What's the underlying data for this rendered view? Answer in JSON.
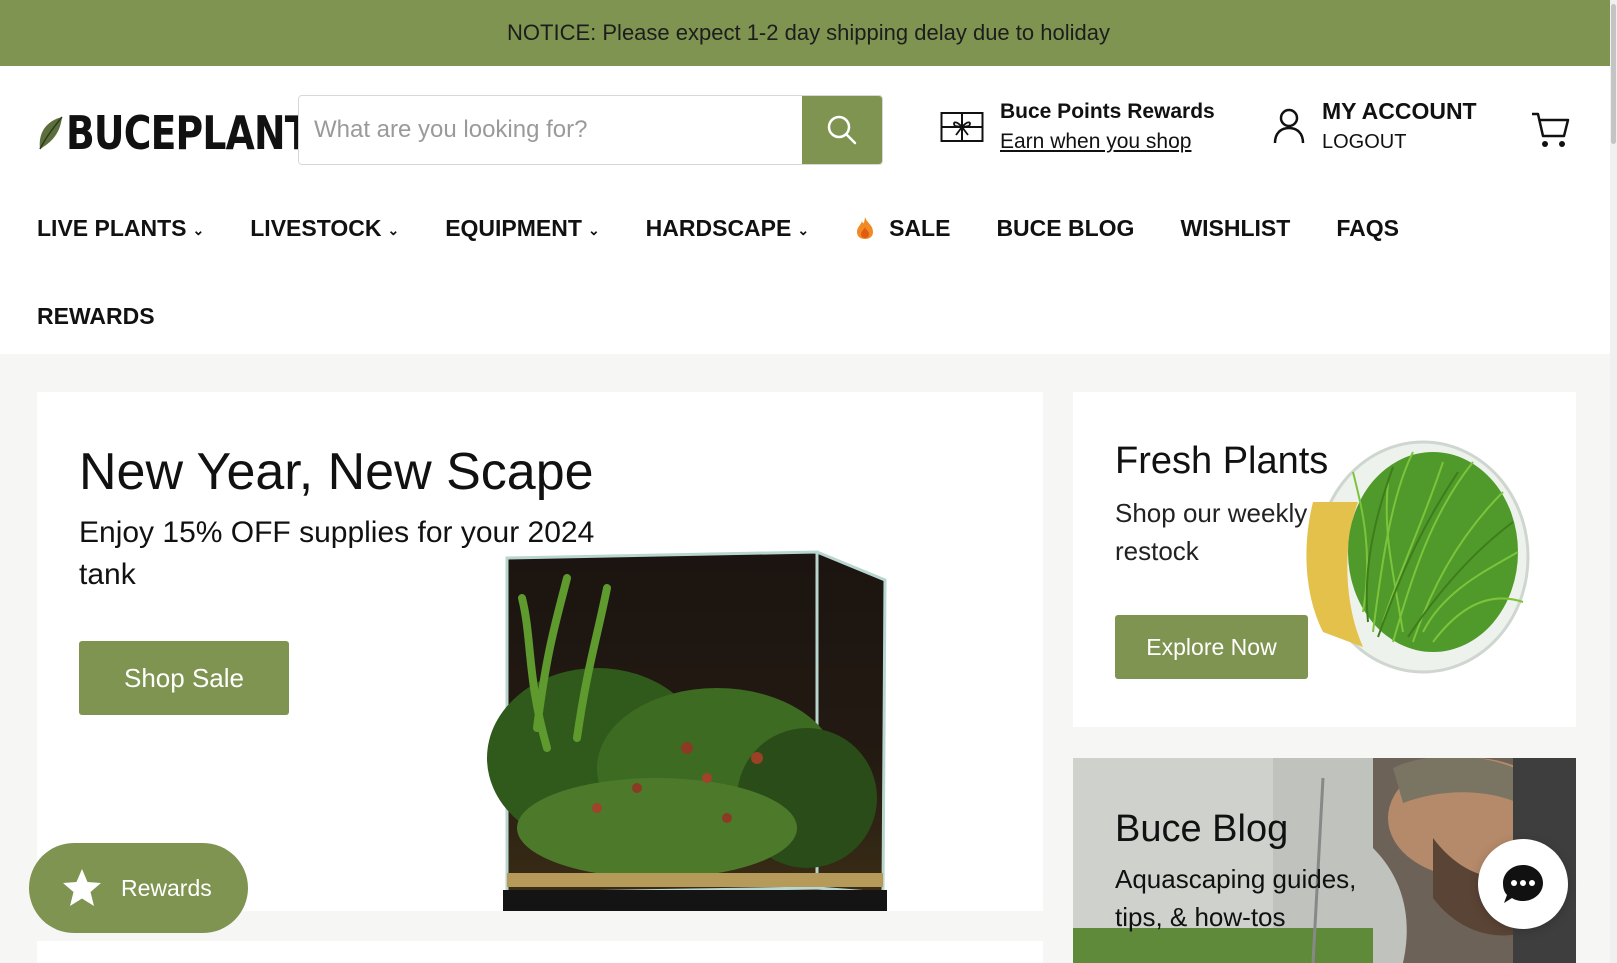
{
  "notice": {
    "text": "NOTICE: Please expect 1-2 day shipping delay due to holiday"
  },
  "header": {
    "logo_text": "BUCEPLANT",
    "search": {
      "placeholder": "What are you looking for?",
      "value": ""
    },
    "rewards": {
      "title": "Buce Points Rewards",
      "link": "Earn when you shop"
    },
    "account": {
      "title": "MY ACCOUNT",
      "logout": "LOGOUT"
    }
  },
  "nav": {
    "items": [
      {
        "label": "LIVE PLANTS",
        "dropdown": true
      },
      {
        "label": "LIVESTOCK",
        "dropdown": true
      },
      {
        "label": "EQUIPMENT",
        "dropdown": true
      },
      {
        "label": "HARDSCAPE",
        "dropdown": true
      },
      {
        "label": "SALE",
        "icon": "fire-icon"
      },
      {
        "label": "BUCE BLOG"
      },
      {
        "label": "WISHLIST"
      },
      {
        "label": "FAQS"
      },
      {
        "label": "REWARDS"
      }
    ]
  },
  "hero": {
    "title": "New Year, New Scape",
    "subtitle": "Enjoy 15% OFF supplies for your 2024 tank",
    "button": "Shop Sale"
  },
  "plants_card": {
    "title": "Fresh Plants",
    "text": "Shop our weekly restock",
    "button": "Explore Now"
  },
  "blog_card": {
    "title": "Buce Blog",
    "text": "Aquascaping guides, tips, & how-tos"
  },
  "widgets": {
    "rewards_label": "Rewards"
  },
  "colors": {
    "brand_green": "#7f9450",
    "text": "#111111",
    "background": "#f6f6f5"
  }
}
